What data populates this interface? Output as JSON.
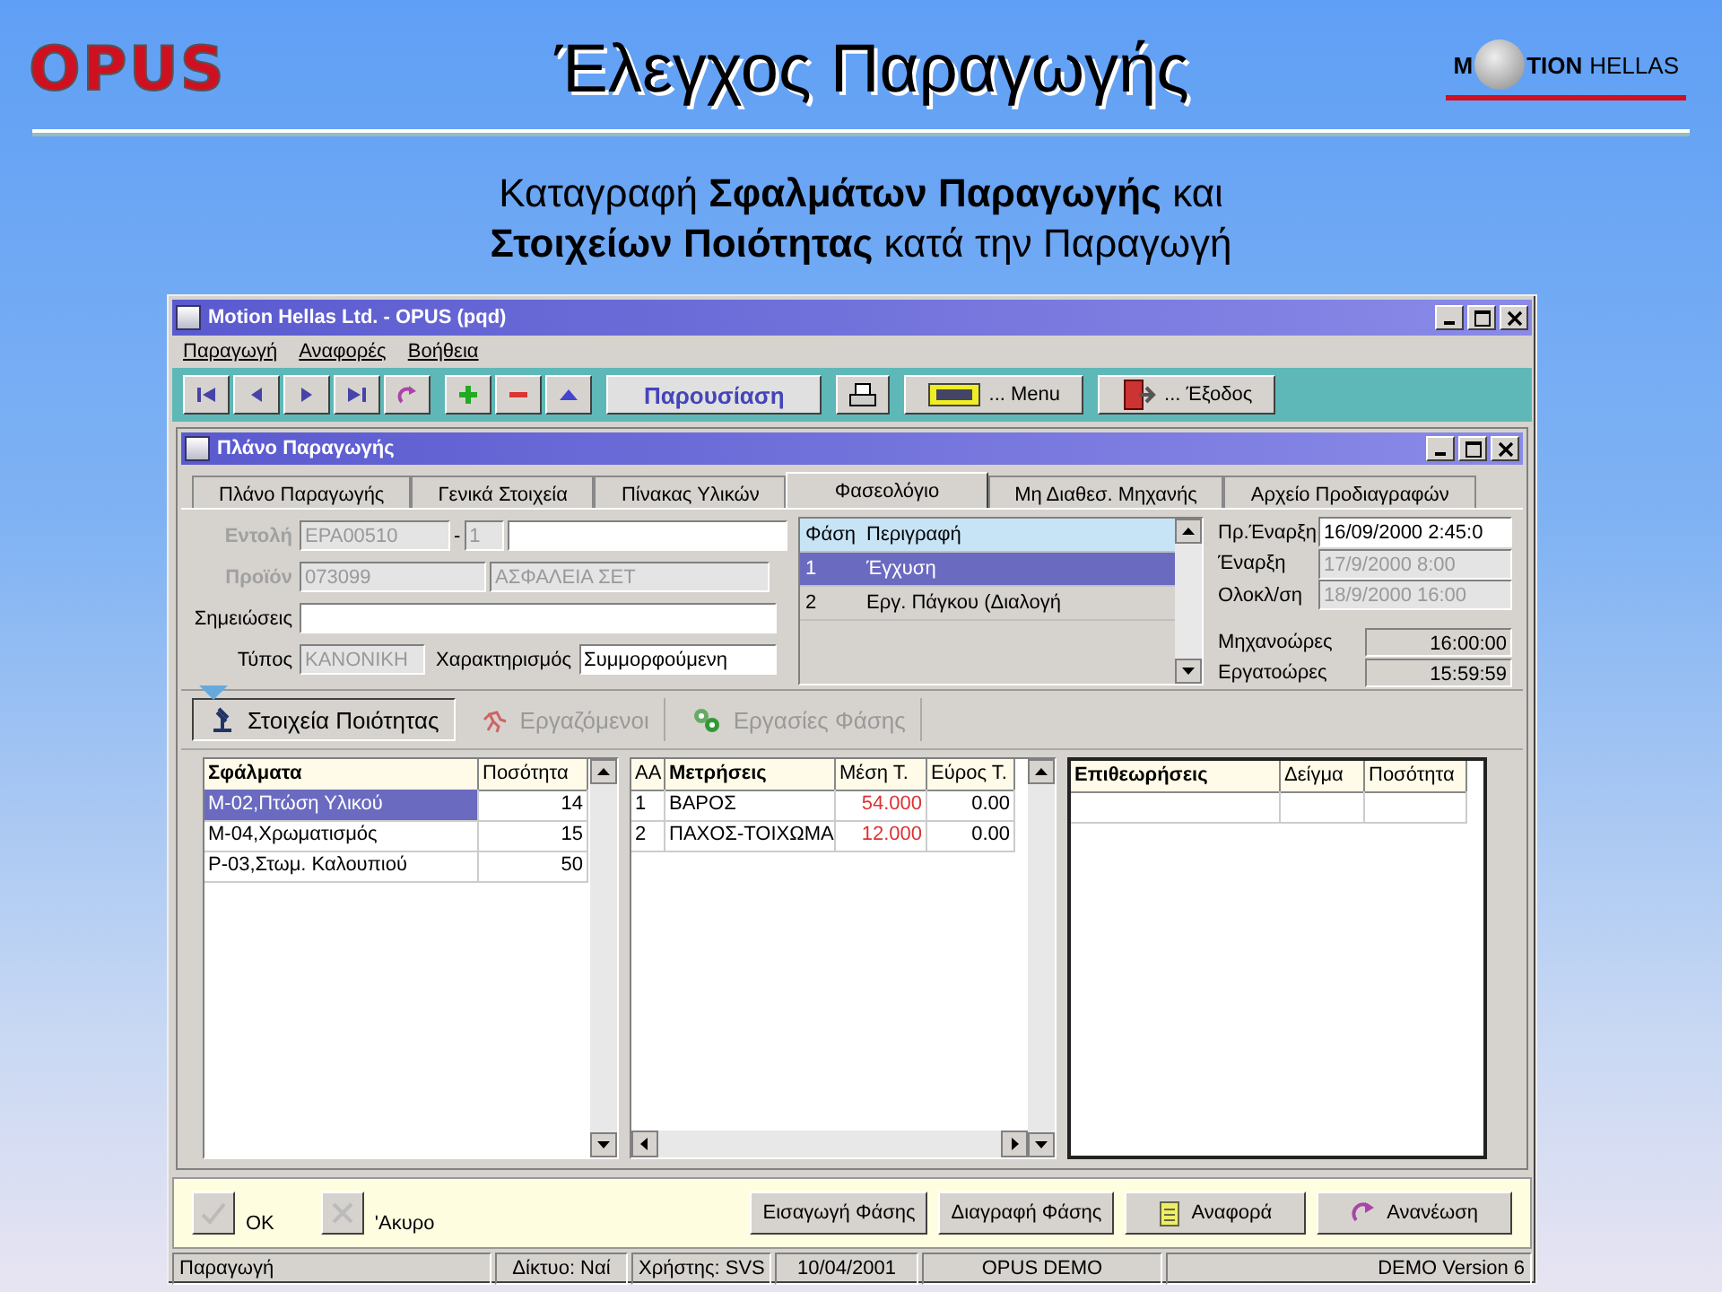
{
  "header": {
    "logo_left": "OPUS",
    "title": "Έλεγχος Παραγωγής",
    "logo_right": {
      "first": "M",
      "rest": "TION",
      "suffix": "HELLAS"
    }
  },
  "subtitle": [
    "Καταγραφή **Σφαλμάτων Παραγωγής** και",
    "**Στοιχείων Ποιότητας** κατά την Παραγωγή"
  ],
  "window": {
    "title": "Motion Hellas Ltd. - OPUS (pqd)",
    "menu": [
      "Παραγωγή",
      "Αναφορές",
      "Βοήθεια"
    ],
    "toolbar": {
      "present": "Παρουσίαση",
      "menu": "... Menu",
      "exit": "... Έξοδος"
    }
  },
  "inner_window": {
    "title": "Πλάνο Παραγωγής"
  },
  "tabs": [
    {
      "label": "Πλάνο Παραγωγής",
      "selected": false
    },
    {
      "label": "Γενικά Στοιχεία",
      "selected": false
    },
    {
      "label": "Πίνακας Υλικών",
      "selected": false
    },
    {
      "label": "Φασεολόγιο",
      "selected": true
    },
    {
      "label": "Μη Διαθεσ. Μηχανής",
      "selected": false
    },
    {
      "label": "Αρχείο Προδιαγραφών",
      "selected": false
    }
  ],
  "form": {
    "order_label": {
      "text": "Εντολή",
      "disabled": true
    },
    "order": {
      "value": "EPA00510",
      "disabled": true
    },
    "order_sep": "-",
    "order_seq": {
      "value": "1",
      "disabled": true
    },
    "product_label": {
      "text": "Προϊόν",
      "disabled": true
    },
    "product_code": {
      "value": "073099",
      "disabled": true
    },
    "product_name": {
      "value": "ΑΣΦΑΛΕΙΑ ΣΕΤ",
      "disabled": true
    },
    "notes_label": "Σημειώσεις",
    "type_label": "Τύπος",
    "type": {
      "value": "ΚΑΝΟΝΙΚΗ",
      "disabled": true
    },
    "char_label": "Χαρακτηρισμός",
    "characterization": {
      "value": "Συμμορφούμενη",
      "disabled": false
    }
  },
  "phases": {
    "columns": [
      "Φάση",
      "Περιγραφή"
    ],
    "rows": [
      {
        "phase": "1",
        "description": "Έγχυση",
        "selected": true
      },
      {
        "phase": "2",
        "description": "Εργ. Πάγκου (Διαλογή",
        "selected": false
      }
    ]
  },
  "dates": [
    {
      "label": "Πρ.Έναρξη",
      "value": "16/09/2000 2:45:0",
      "disabled": false
    },
    {
      "label": "Έναρξη",
      "value": "17/9/2000 8:00",
      "disabled": true
    },
    {
      "label": "Ολοκλ/ση",
      "value": "18/9/2000 16:00",
      "disabled": true
    }
  ],
  "hours": [
    {
      "label": "Μηχανοώρες",
      "value": "16:00:00"
    },
    {
      "label": "Εργατοώρες",
      "value": "15:59:59"
    }
  ],
  "subtabs": [
    {
      "label": "Στοιχεία Ποιότητας",
      "selected": true
    },
    {
      "label": "Εργαζόμενοι",
      "selected": false
    },
    {
      "label": "Εργασίες Φάσης",
      "selected": false
    }
  ],
  "defects": {
    "columns": [
      "Σφάλματα",
      "Ποσότητα"
    ],
    "rows": [
      {
        "name": "M-02,Πτώση Υλικού",
        "qty": "14",
        "selected": true
      },
      {
        "name": "M-04,Χρωματισμός",
        "qty": "15",
        "selected": false
      },
      {
        "name": "P-03,Στωμ. Καλουπιού",
        "qty": "50",
        "selected": false
      }
    ]
  },
  "measurements": {
    "columns": [
      "ΑΑ",
      "Μετρήσεις",
      "Μέση Τ.",
      "Εύρος Τ."
    ],
    "rows": [
      {
        "aa": "1",
        "name": "ΒΑΡΟΣ",
        "mean": "54.000",
        "range": "0.00"
      },
      {
        "aa": "2",
        "name": "ΠΑΧΟΣ-ΤΟΙΧΩΜΑ",
        "mean": "12.000",
        "range": "0.00"
      }
    ]
  },
  "inspections": {
    "columns": [
      "Επιθεωρήσεις",
      "Δείγμα",
      "Ποσότητα"
    ]
  },
  "bottom": {
    "ok": {
      "label": "OK",
      "disabled": true
    },
    "cancel": {
      "label": "'Ακυρο",
      "disabled": true
    },
    "buttons": [
      "Εισαγωγή Φάσης",
      "Διαγραφή Φάσης",
      "Αναφορά",
      "Ανανέωση"
    ]
  },
  "status_bar": [
    "Παραγωγή",
    "Δίκτυο: Ναί",
    "Χρήστης: SVS",
    "10/04/2001",
    "OPUS DEMO",
    "DEMO Version 6"
  ]
}
